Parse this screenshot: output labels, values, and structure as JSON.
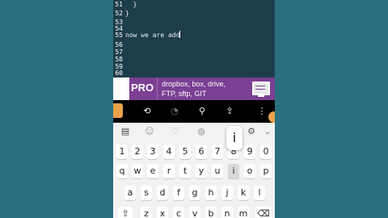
{
  "editor": {
    "lines": [
      {
        "n": "51",
        "text": "  }"
      },
      {
        "n": "52",
        "text": "}"
      },
      {
        "n": "53",
        "text": ""
      },
      {
        "n": "54",
        "text": ""
      },
      {
        "n": "55",
        "text": "now we are add"
      },
      {
        "n": "56",
        "text": ""
      },
      {
        "n": "57",
        "text": ""
      },
      {
        "n": "58",
        "text": ""
      },
      {
        "n": "59",
        "text": ""
      },
      {
        "n": "60",
        "text": ""
      }
    ]
  },
  "banner": {
    "badge": "PRO",
    "line1": "dropbox, box, drive,",
    "line2": "FTP, sftp, GIT",
    "icon": "monitor-icon"
  },
  "toolbar": {
    "icons": [
      "history-icon",
      "clock-icon",
      "search-icon",
      "upload-icon",
      "more-icon"
    ]
  },
  "keyboard": {
    "top_icons": [
      "clipboard-icon",
      "sticker-icon",
      "emoji-icon",
      "globe-icon",
      "settings-icon",
      "collapse-icon"
    ],
    "number_row": [
      "1",
      "2",
      "3",
      "4",
      "5",
      "6",
      "7",
      "8",
      "9",
      "0"
    ],
    "row1": [
      "q",
      "w",
      "e",
      "r",
      "t",
      "y",
      "u",
      "i",
      "o",
      "p"
    ],
    "row2": [
      "a",
      "s",
      "d",
      "f",
      "g",
      "h",
      "j",
      "k",
      "l"
    ],
    "row3": [
      "z",
      "x",
      "c",
      "v",
      "b",
      "n",
      "m"
    ],
    "popup_key": "i"
  },
  "colors": {
    "background": "#2a6f7f",
    "editor_bg": "#1e3d4a",
    "banner": "#7b3f93",
    "accent": "#e9a24a"
  }
}
